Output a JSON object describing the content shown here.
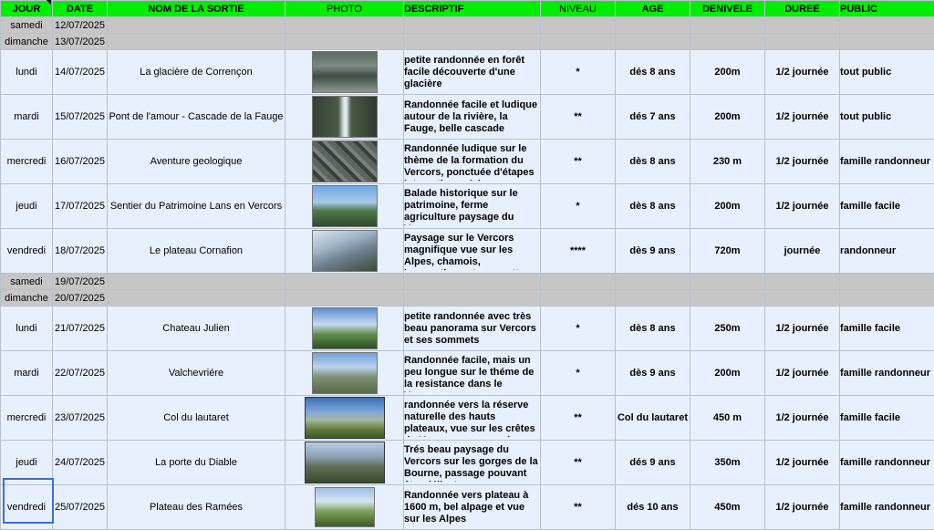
{
  "headers": {
    "jour": "JOUR",
    "date": "DATE",
    "nom": "NOM DE LA SORTIE",
    "photo": "PHOTO",
    "descriptif": "DESCRIPTIF",
    "niveau": "NIVEAU",
    "age": "AGE",
    "denivele": "DENIVELE",
    "duree": "DUREE",
    "public": "PUBLIC"
  },
  "rows": [
    {
      "type": "weekend",
      "jour": "samedi",
      "date": "12/07/2025"
    },
    {
      "type": "weekend",
      "jour": "dimanche",
      "date": "13/07/2025"
    },
    {
      "type": "sortie",
      "jour": "lundi",
      "date": "14/07/2025",
      "nom": "La glacière de Corrençon",
      "photo": "forest-glacier-photo",
      "descriptif": "petite randonnée en forêt facile découverte d'une glacière",
      "niveau": "*",
      "age": "dés 8 ans",
      "denivele": "200m",
      "duree": "1/2 journée",
      "public": "tout public"
    },
    {
      "type": "sortie",
      "jour": "mardi",
      "date": "15/07/2025",
      "nom": "Pont de l'amour - Cascade de la Fauge",
      "photo": "waterfall-photo",
      "descriptif": "Randonnée facile et ludique autour de la rivière, la Fauge, belle cascade",
      "niveau": "**",
      "age": "dés 7 ans",
      "denivele": "200m",
      "duree": "1/2 journée",
      "public": "tout public"
    },
    {
      "type": "sortie",
      "jour": "mercredi",
      "date": "16/07/2025",
      "nom": "Aventure geologique",
      "photo": "limestone-pavement-photo",
      "descriptif": "Randonnée ludique sur le thème de la formation du Vercors, ponctuée d'étapes interactives où les",
      "niveau": "**",
      "age": "dès 8 ans",
      "denivele": "230 m",
      "duree": "1/2 journée",
      "public": "famille randonneur"
    },
    {
      "type": "sortie",
      "jour": "jeudi",
      "date": "17/07/2025",
      "nom": "Sentier du Patrimoine Lans en Vercors",
      "photo": "meadow-photo",
      "descriptif": "Balade historique sur le patrimoine, ferme agriculture paysage du Vercors",
      "niveau": "*",
      "age": "dès 8 ans",
      "denivele": "200m",
      "duree": "1/2 journée",
      "public": "famille facile"
    },
    {
      "type": "sortie",
      "jour": "vendredi",
      "date": "18/07/2025",
      "nom": "Le plateau Cornafion",
      "photo": "mountain-ridge-photo",
      "descriptif": "Paysage sur le Vercors magnifique vue sur les Alpes, chamois, bouquetions et marmottes",
      "niveau": "****",
      "age": "dès 9 ans",
      "denivele": "720m",
      "duree": "journée",
      "public": "randonneur"
    },
    {
      "type": "weekend",
      "jour": "samedi",
      "date": "19/07/2025"
    },
    {
      "type": "weekend",
      "jour": "dimanche",
      "date": "20/07/2025"
    },
    {
      "type": "sortie",
      "jour": "lundi",
      "date": "21/07/2025",
      "nom": "Chateau Julien",
      "photo": "panorama-photo",
      "descriptif": "petite randonnée avec très beau panorama sur Vercors et ses sommets",
      "niveau": "*",
      "age": "dès 8 ans",
      "denivele": "250m",
      "duree": "1/2 journée",
      "public": "famille facile"
    },
    {
      "type": "sortie",
      "jour": "mardi",
      "date": "22/07/2025",
      "nom": "Valchevriére",
      "photo": "village-ruins-photo",
      "descriptif": "Randonnée facile, mais un peu longue sur le théme de la resistance dans le Vercors",
      "niveau": "*",
      "age": "dès 9 ans",
      "denivele": "200m",
      "duree": "1/2 journée",
      "public": "famille randonneur"
    },
    {
      "type": "sortie",
      "jour": "mercredi",
      "date": "23/07/2025",
      "nom": "Col du lautaret",
      "photo": "plateau-photo",
      "descriptif": "randonnée vers la réserve naturelle des hauts plateaux, vue sur les crêtes du Vercors, promenade",
      "niveau": "**",
      "age": "Col du lautaret",
      "denivele": "450 m",
      "duree": "1/2 journée",
      "public": "famille facile"
    },
    {
      "type": "sortie",
      "jour": "jeudi",
      "date": "24/07/2025",
      "nom": "La porte du Diable",
      "photo": "gorges-photo",
      "descriptif": "Trés beau paysage du Vercors sur les gorges de la Bourne, passage pouvant être délicat",
      "niveau": "**",
      "age": "dés 9 ans",
      "denivele": "350m",
      "duree": "1/2 journée",
      "public": "famille randonneur"
    },
    {
      "type": "sortie",
      "jour": "vendredi",
      "date": "25/07/2025",
      "nom": "Plateau des Ramées",
      "photo": "alpine-pasture-photo",
      "descriptif": "Randonnée vers plateau à 1600 m, bel alpage et vue sur les Alpes",
      "niveau": "**",
      "age": "dés 10 ans",
      "denivele": "450m",
      "duree": "1/2 journée",
      "public": "famille randonneur"
    }
  ]
}
